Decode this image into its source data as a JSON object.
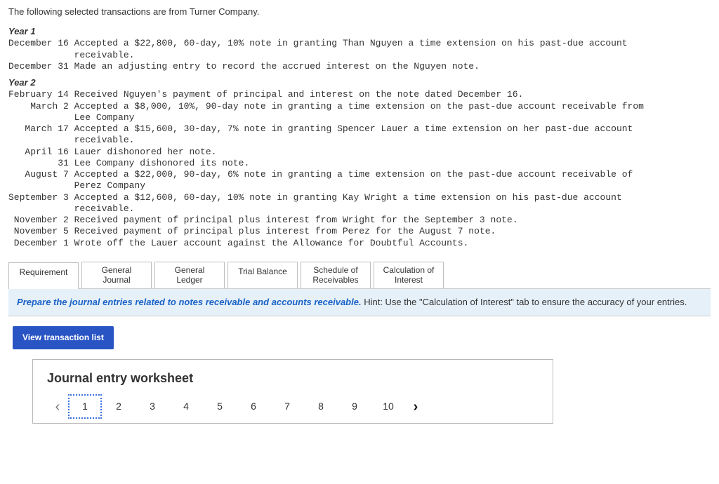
{
  "intro": "The following selected transactions are from Turner Company.",
  "year1": {
    "heading": "Year 1",
    "lines": [
      "December 16 Accepted a $22,800, 60-day, 10% note in granting Than Nguyen a time extension on his past-due account",
      "            receivable.",
      "December 31 Made an adjusting entry to record the accrued interest on the Nguyen note."
    ]
  },
  "year2": {
    "heading": "Year 2",
    "lines": [
      "February 14 Received Nguyen's payment of principal and interest on the note dated December 16.",
      "    March 2 Accepted a $8,000, 10%, 90-day note in granting a time extension on the past-due account receivable from",
      "            Lee Company",
      "   March 17 Accepted a $15,600, 30-day, 7% note in granting Spencer Lauer a time extension on her past-due account",
      "            receivable.",
      "   April 16 Lauer dishonored her note.",
      "         31 Lee Company dishonored its note.",
      "   August 7 Accepted a $22,000, 90-day, 6% note in granting a time extension on the past-due account receivable of",
      "            Perez Company",
      "September 3 Accepted a $12,600, 60-day, 10% note in granting Kay Wright a time extension on his past-due account",
      "            receivable.",
      " November 2 Received payment of principal plus interest from Wright for the September 3 note.",
      " November 5 Received payment of principal plus interest from Perez for the August 7 note.",
      " December 1 Wrote off the Lauer account against the Allowance for Doubtful Accounts."
    ]
  },
  "tabs": {
    "requirement": "Requirement",
    "general_journal_l1": "General",
    "general_journal_l2": "Journal",
    "general_ledger_l1": "General",
    "general_ledger_l2": "Ledger",
    "trial_balance": "Trial Balance",
    "schedule_l1": "Schedule of",
    "schedule_l2": "Receivables",
    "calc_l1": "Calculation of",
    "calc_l2": "Interest"
  },
  "instruction": {
    "lead": "Prepare the journal entries related to notes receivable and accounts receivable.",
    "rest": " Hint:  Use the \"Calculation of Interest\" tab to ensure the accuracy of your entries."
  },
  "view_btn": "View transaction list",
  "worksheet": {
    "title": "Journal entry worksheet",
    "pages": [
      "1",
      "2",
      "3",
      "4",
      "5",
      "6",
      "7",
      "8",
      "9",
      "10"
    ]
  }
}
